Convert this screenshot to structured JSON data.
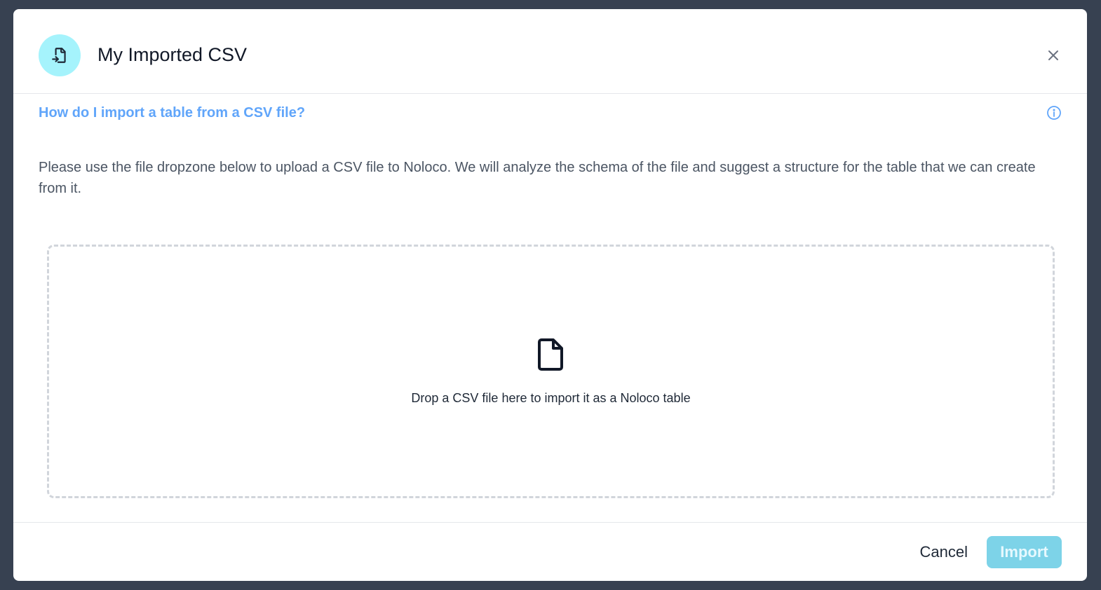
{
  "modal": {
    "title": "My Imported CSV",
    "help_link": "How do I import a table from a CSV file?",
    "description": "Please use the file dropzone below to upload a CSV file to Noloco. We will analyze the schema of the file and suggest a structure for the table that we can create from it.",
    "dropzone_text": "Drop a CSV file here to import it as a Noloco table",
    "cancel_label": "Cancel",
    "import_label": "Import",
    "import_disabled": true
  },
  "icons": {
    "header": "file-import-icon",
    "close": "close-icon",
    "info": "info-icon",
    "dropzone": "file-icon"
  },
  "colors": {
    "accent": "#60a5fa",
    "header_icon_bg": "#a5f3fc",
    "import_button_bg": "#7dd3e8",
    "backdrop": "#374151"
  }
}
